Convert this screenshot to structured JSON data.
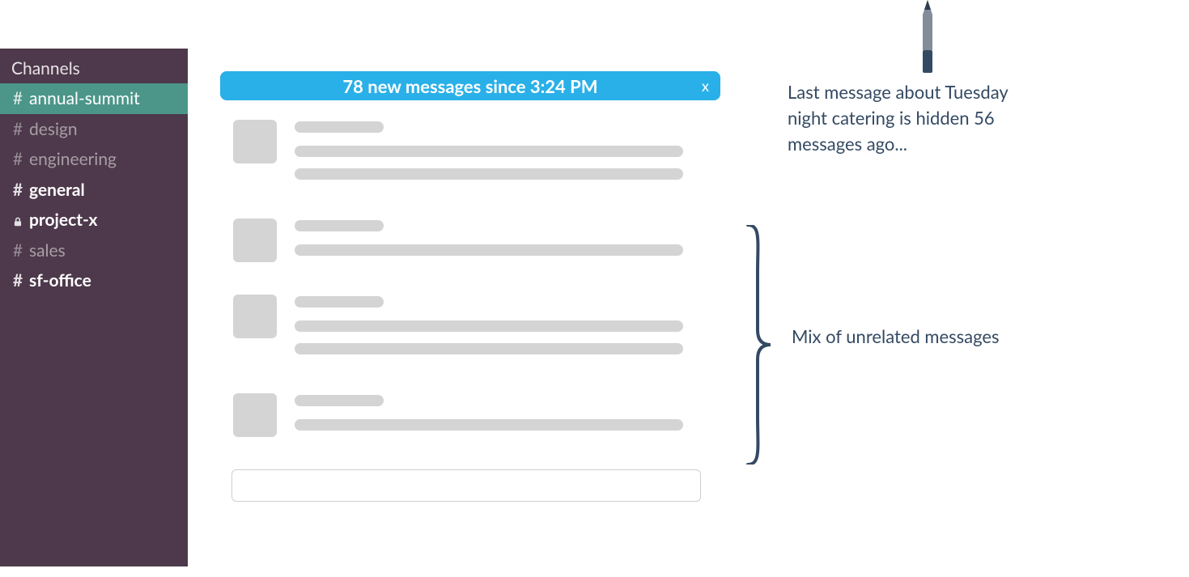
{
  "sidebar": {
    "header": "Channels",
    "items": [
      {
        "prefix": "#",
        "label": "annual-summit",
        "selected": true,
        "bold": false,
        "icon": "hash"
      },
      {
        "prefix": "#",
        "label": "design",
        "selected": false,
        "bold": false,
        "icon": "hash"
      },
      {
        "prefix": "#",
        "label": "engineering",
        "selected": false,
        "bold": false,
        "icon": "hash"
      },
      {
        "prefix": "#",
        "label": "general",
        "selected": false,
        "bold": true,
        "icon": "hash"
      },
      {
        "prefix": "",
        "label": "project-x",
        "selected": false,
        "bold": true,
        "icon": "lock"
      },
      {
        "prefix": "#",
        "label": "sales",
        "selected": false,
        "bold": false,
        "icon": "hash"
      },
      {
        "prefix": "#",
        "label": "sf-office",
        "selected": false,
        "bold": true,
        "icon": "hash"
      }
    ]
  },
  "banner": {
    "text": "78 new messages since 3:24 PM",
    "close": "x"
  },
  "annotations": {
    "top": "Last message about Tuesday night catering is hidden 56 messages ago...",
    "brace": "Mix of unrelated messages"
  },
  "placeholder_messages": [
    {
      "lines": 3
    },
    {
      "lines": 2
    },
    {
      "lines": 3
    },
    {
      "lines": 2
    }
  ],
  "colors": {
    "sidebar_bg": "#4d394b",
    "sidebar_selected": "#4c9689",
    "banner_bg": "#2ab0e8",
    "placeholder": "#d4d4d4",
    "annotation_text": "#344a63"
  }
}
